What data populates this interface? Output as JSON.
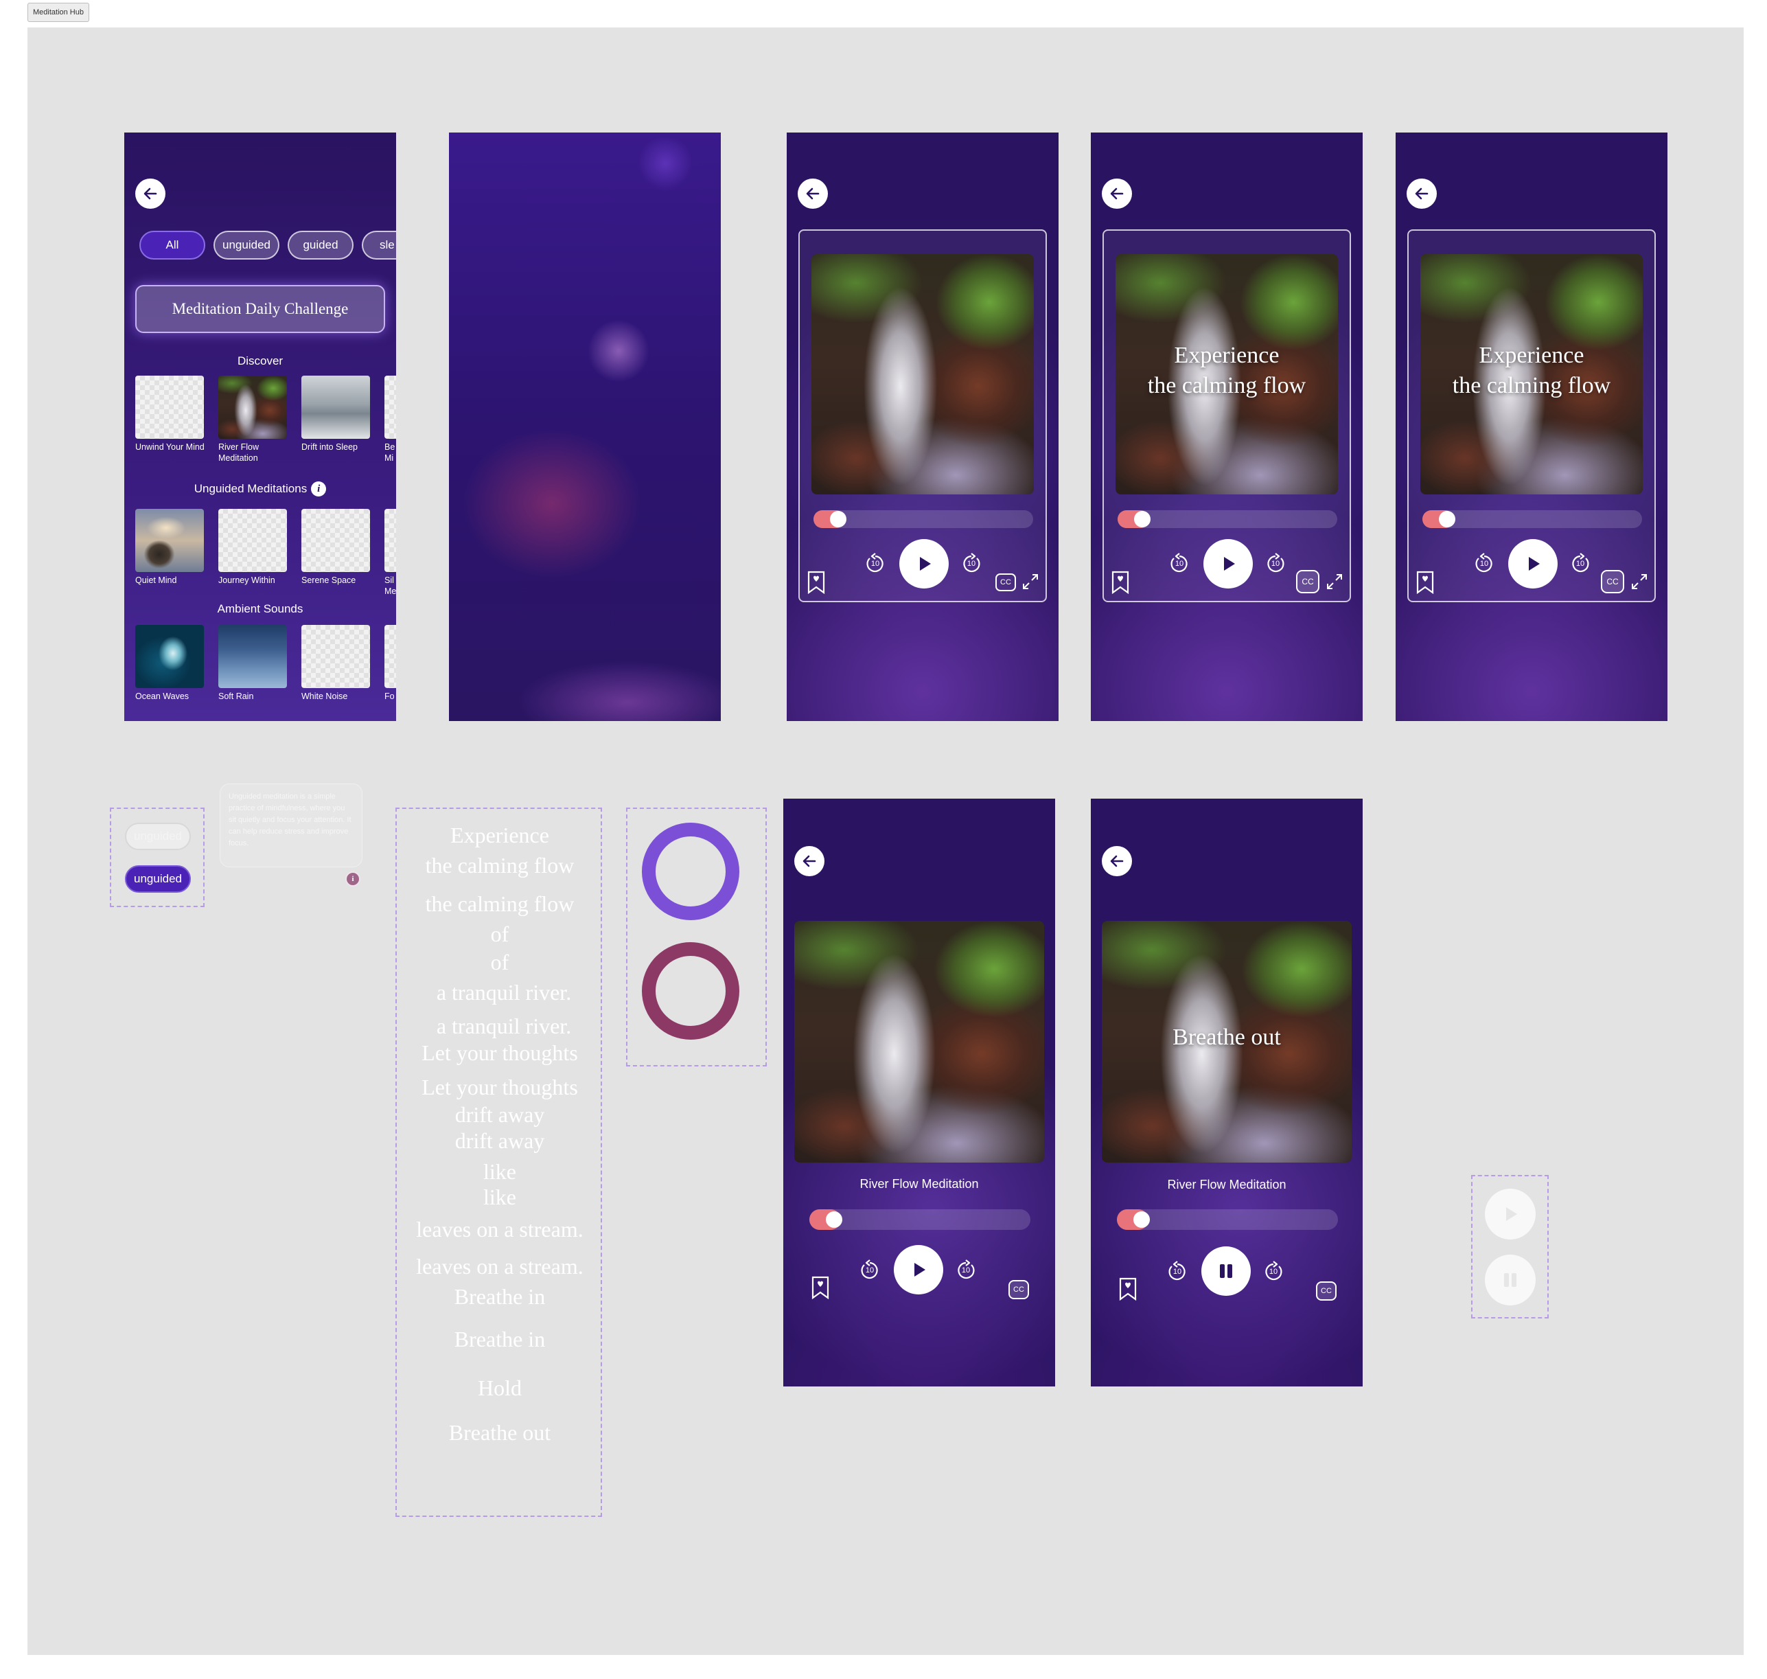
{
  "page": {
    "label": "Meditation Hub"
  },
  "library": {
    "chips": [
      "All",
      "unguided",
      "guided",
      "sle"
    ],
    "challenge": "Meditation Daily Challenge",
    "discover": {
      "title": "Discover",
      "items": [
        "Unwind Your Mind",
        "River Flow Meditation",
        "Drift into Sleep",
        "Be Mi"
      ]
    },
    "unguided": {
      "title": "Unguided Meditations",
      "items": [
        "Quiet Mind",
        "Journey Within",
        "Serene Space",
        "Sil Me"
      ]
    },
    "ambient": {
      "title": "Ambient Sounds",
      "items": [
        "Ocean Waves",
        "Soft Rain",
        "White Noise",
        "Fo"
      ]
    }
  },
  "player": {
    "overlay_line1": "Experience",
    "overlay_line2": "the calming flow",
    "breathe_out": "Breathe out",
    "track_title": "River Flow Meditation",
    "skip_seconds": "10",
    "cc_label": "CC",
    "progress": 0.1
  },
  "components": {
    "chip_default": "unguided",
    "chip_selected": "unguided",
    "tooltip": "Unguided meditation is a simple practice of mindfulness, where you sit quietly and focus your attention. It can help reduce stress and improve focus.",
    "ring_colors": [
      "#7b4fd6",
      "#8c3a65"
    ]
  },
  "lyrics": [
    "Experience",
    "the calming flow",
    "the calming flow",
    "of",
    "of",
    "a tranquil river.",
    "a tranquil river.",
    "Let your thoughts",
    "Let your thoughts",
    "drift away",
    "drift away",
    "like",
    "like",
    "leaves on a stream.",
    "leaves on a stream.",
    "Breathe in",
    "Breathe in",
    "Hold",
    "Breathe out"
  ],
  "colors": {
    "screen_bg": "#2a1360",
    "accent": "#4a22b5",
    "progress": "#e8737a",
    "canvas": "#e3e3e3"
  }
}
